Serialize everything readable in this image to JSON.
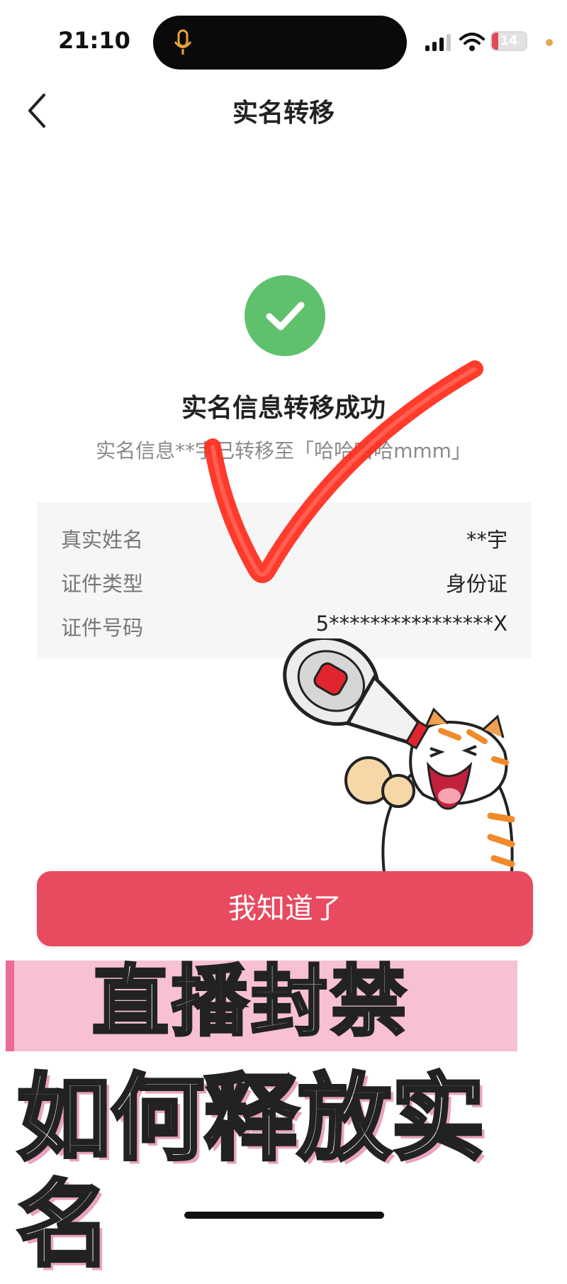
{
  "status_bar": {
    "time": "21:10",
    "battery": "14"
  },
  "nav": {
    "title": "实名转移"
  },
  "success": {
    "title": "实名信息转移成功",
    "description": "实名信息**宇已转移至「哈哈哈哈mmm」"
  },
  "info": {
    "rows": [
      {
        "label": "真实姓名",
        "value": "**宇"
      },
      {
        "label": "证件类型",
        "value": "身份证"
      },
      {
        "label": "证件号码",
        "value": "5****************X"
      }
    ]
  },
  "button": {
    "label": "我知道了"
  },
  "overlay": {
    "line1": "直播封禁",
    "line2": "如何释放实名"
  },
  "colors": {
    "accent": "#e84a5f",
    "success": "#5fc16c",
    "overlay_pink": "#f7c1d1"
  },
  "icons": [
    "microphone-icon",
    "signal-icon",
    "wifi-icon",
    "battery-icon",
    "back-arrow-icon",
    "check-icon",
    "megaphone-tiger-sticker"
  ]
}
